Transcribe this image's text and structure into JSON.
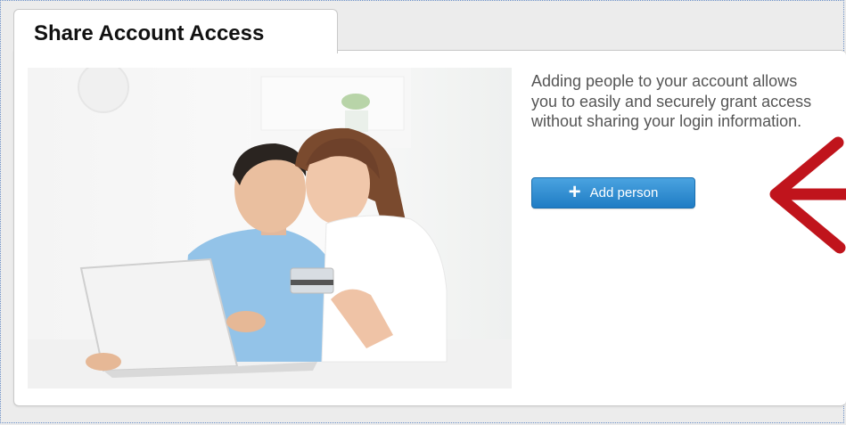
{
  "tab": {
    "title": "Share Account Access"
  },
  "content": {
    "description": "Adding people to your account allows you to easily and securely grant access without sharing your login information.",
    "add_button": {
      "label": "Add person",
      "icon": "plus-icon"
    }
  },
  "photo": {
    "subject": "couple-with-laptop-and-card"
  },
  "colors": {
    "button_top": "#4aa3e0",
    "button_bottom": "#1f7cc4",
    "arrow": "#c0141c",
    "text": "#555555"
  }
}
